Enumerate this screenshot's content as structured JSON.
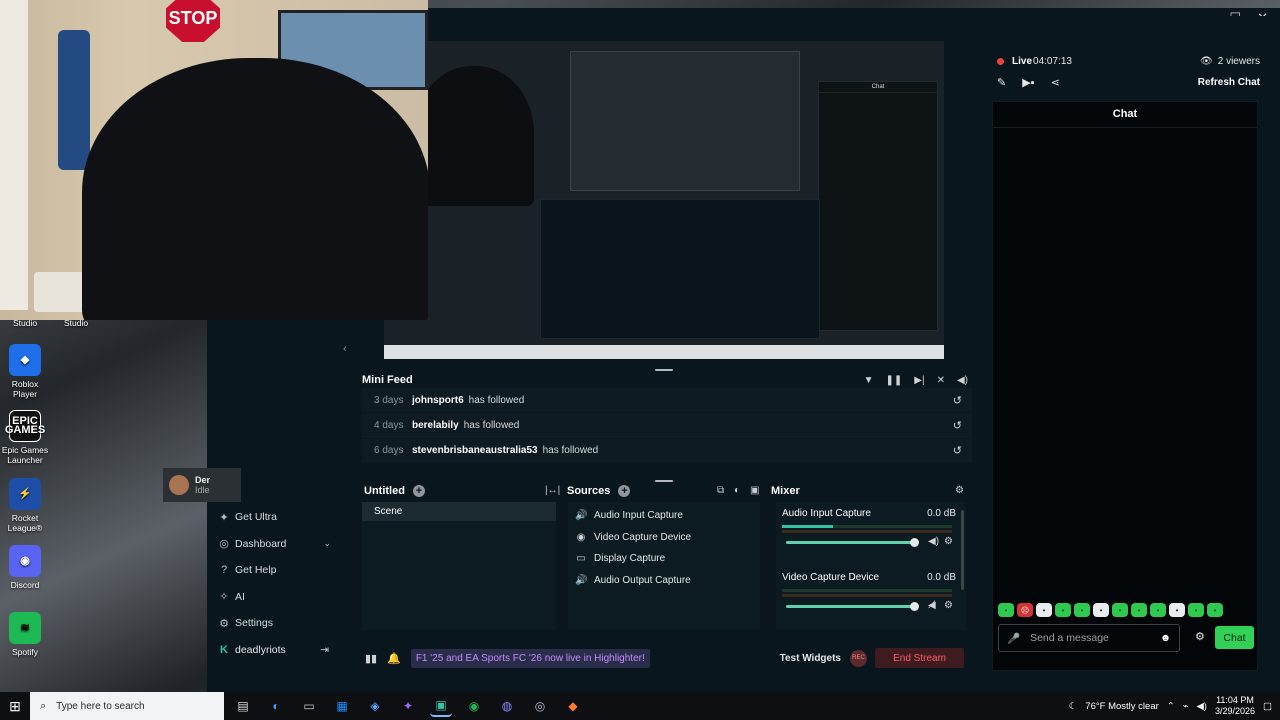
{
  "desktop": {
    "studio_labels": [
      "Studio",
      "Studio"
    ],
    "icons": [
      {
        "label": "Roblox Player",
        "glyph": "◆",
        "icon": "roblox-icon"
      },
      {
        "label": "Epic Games Launcher",
        "glyph": "EPIC GAMES",
        "icon": "epic-games-icon"
      },
      {
        "label": "Rocket League®",
        "glyph": "⚡",
        "icon": "rocket-league-icon"
      },
      {
        "label": "Discord",
        "glyph": "◉",
        "icon": "discord-icon"
      },
      {
        "label": "Spotify",
        "glyph": "≋",
        "icon": "spotify-icon"
      }
    ]
  },
  "webcam": {
    "stop_sign": "STOP"
  },
  "app": {
    "window_controls": [
      "—",
      "☐",
      "✕"
    ],
    "nav": {
      "items": [
        {
          "label": "Get Ultra",
          "icon": "ultra-icon",
          "glyph": "✦"
        },
        {
          "label": "Dashboard",
          "icon": "dashboard-icon",
          "glyph": "◎",
          "chevron": "⌄"
        },
        {
          "label": "Get Help",
          "icon": "help-icon",
          "glyph": "?"
        },
        {
          "label": "AI",
          "icon": "ai-icon",
          "glyph": "✧"
        },
        {
          "label": "Settings",
          "icon": "settings-icon",
          "glyph": "⚙"
        }
      ],
      "user": {
        "name": "deadlyriots",
        "glyph": "K",
        "logout": "⇥"
      },
      "mini_user": {
        "name": "Der",
        "status": "Idle"
      }
    },
    "mini_feed": {
      "title": "Mini Feed",
      "events": [
        {
          "time": "3 days",
          "user": "johnsport6",
          "action": "has followed"
        },
        {
          "time": "4 days",
          "user": "berelabily",
          "action": "has followed"
        },
        {
          "time": "6 days",
          "user": "stevenbrisbaneaustralia53",
          "action": "has followed"
        }
      ]
    },
    "scenes": {
      "title": "Untitled",
      "items": [
        "Scene"
      ]
    },
    "sources": {
      "title": "Sources",
      "items": [
        {
          "label": "Audio Input Capture",
          "glyph": "🔊",
          "icon": "speaker-icon"
        },
        {
          "label": "Video Capture Device",
          "glyph": "◉",
          "icon": "webcam-icon"
        },
        {
          "label": "Display Capture",
          "glyph": "▭",
          "icon": "monitor-icon"
        },
        {
          "label": "Audio Output Capture",
          "glyph": "🔊",
          "icon": "speaker-icon"
        }
      ]
    },
    "mixer": {
      "title": "Mixer",
      "items": [
        {
          "label": "Audio Input Capture",
          "db": "0.0 dB",
          "meter_level": 0.3,
          "volume": 1.0
        },
        {
          "label": "Video Capture Device",
          "db": "0.0 dB",
          "meter_level": 0.0,
          "volume": 1.0
        }
      ]
    },
    "bottom": {
      "banner": "F1 '25 and EA Sports FC '26 now live in Highlighter!",
      "test_widgets": "Test Widgets",
      "rec": "REC",
      "end_stream": "End Stream"
    },
    "chat_panel": {
      "live_label": "Live",
      "live_time": "04:07:13",
      "viewers": "2 viewers",
      "refresh": "Refresh Chat",
      "chat_title": "Chat",
      "input_placeholder": "Send a message",
      "chat_button": "Chat"
    }
  },
  "taskbar": {
    "search_placeholder": "Type here to search",
    "weather": "76°F  Mostly clear",
    "time": "11:04 PM",
    "date": "3/29/2026"
  },
  "colors": {
    "accent_green": "#31d158",
    "teal": "#31c3a2",
    "live_red": "#f23e3e",
    "panel_bg": "#09161d"
  }
}
